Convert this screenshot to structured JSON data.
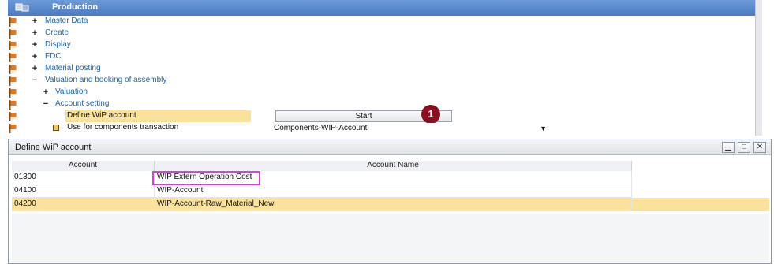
{
  "tree": {
    "header_title": "Production",
    "items": [
      {
        "toggle": "+",
        "label": "Master Data"
      },
      {
        "toggle": "+",
        "label": "Create"
      },
      {
        "toggle": "+",
        "label": "Display"
      },
      {
        "toggle": "+",
        "label": "FDC"
      },
      {
        "toggle": "+",
        "label": "Material posting"
      },
      {
        "toggle": "−",
        "label": "Valuation and booking of assembly"
      },
      {
        "toggle": "+",
        "label": "Valuation"
      },
      {
        "toggle": "−",
        "label": "Account setting"
      },
      {
        "toggle": "",
        "label": "Define WiP account"
      },
      {
        "toggle": "",
        "label": "Use for components transaction"
      }
    ],
    "start_button": "Start",
    "badge": "1",
    "combo_value": "Components-WIP-Account"
  },
  "dialog": {
    "title": "Define WiP account",
    "columns": [
      "Account",
      "Account Name"
    ],
    "rows": [
      {
        "account": "01300",
        "name": "WIP Extern Operation Cost"
      },
      {
        "account": "04100",
        "name": "WIP-Account"
      },
      {
        "account": "04200",
        "name": "WIP-Account-Raw_Material_New"
      }
    ]
  },
  "colors": {
    "header_blue": "#4a7bc4",
    "link_blue": "#2266a8",
    "selection": "#fbe29a",
    "highlight_border": "#d63fe0",
    "badge": "#8a1020",
    "flag": "#e8771a"
  }
}
